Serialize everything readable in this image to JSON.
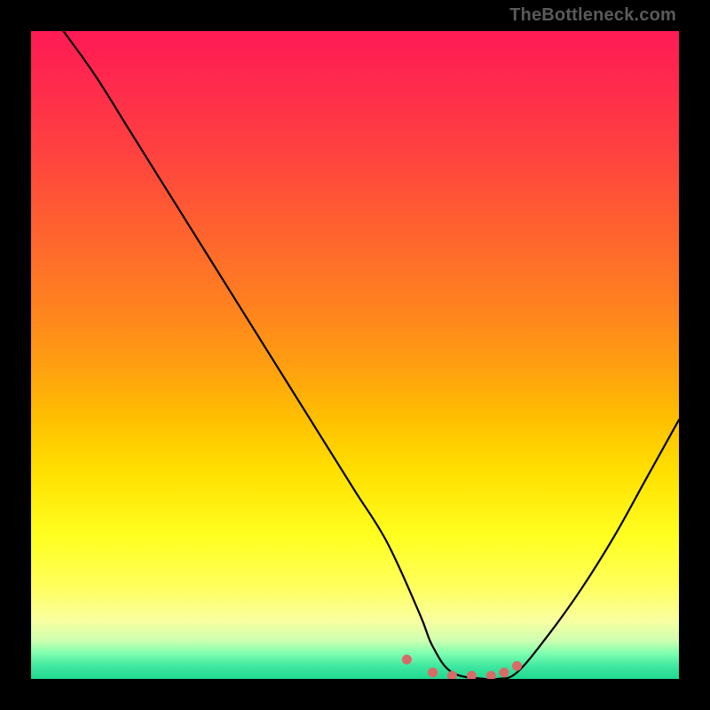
{
  "watermark": "TheBottleneck.com",
  "chart_data": {
    "type": "line",
    "title": "",
    "xlabel": "",
    "ylabel": "",
    "xlim": [
      0,
      100
    ],
    "ylim": [
      0,
      100
    ],
    "grid": false,
    "legend": false,
    "series": [
      {
        "name": "bottleneck-curve",
        "x": [
          5,
          10,
          15,
          20,
          25,
          30,
          35,
          40,
          45,
          50,
          55,
          60,
          62,
          65,
          70,
          72,
          75,
          80,
          85,
          90,
          95,
          100
        ],
        "y": [
          100,
          93,
          85,
          77,
          69,
          61,
          53,
          45,
          37,
          29,
          21,
          10,
          5,
          1,
          0,
          0,
          1,
          7,
          14,
          22,
          31,
          40
        ]
      },
      {
        "name": "highlight-dots",
        "x": [
          58,
          62,
          65,
          68,
          71,
          73,
          75
        ],
        "y": [
          3,
          1,
          0.5,
          0.5,
          0.5,
          1,
          2
        ]
      }
    ],
    "background_gradient": {
      "top": "#ff1a55",
      "bottom": "#20d890",
      "meaning": "red=high bottleneck, green=optimal"
    }
  }
}
